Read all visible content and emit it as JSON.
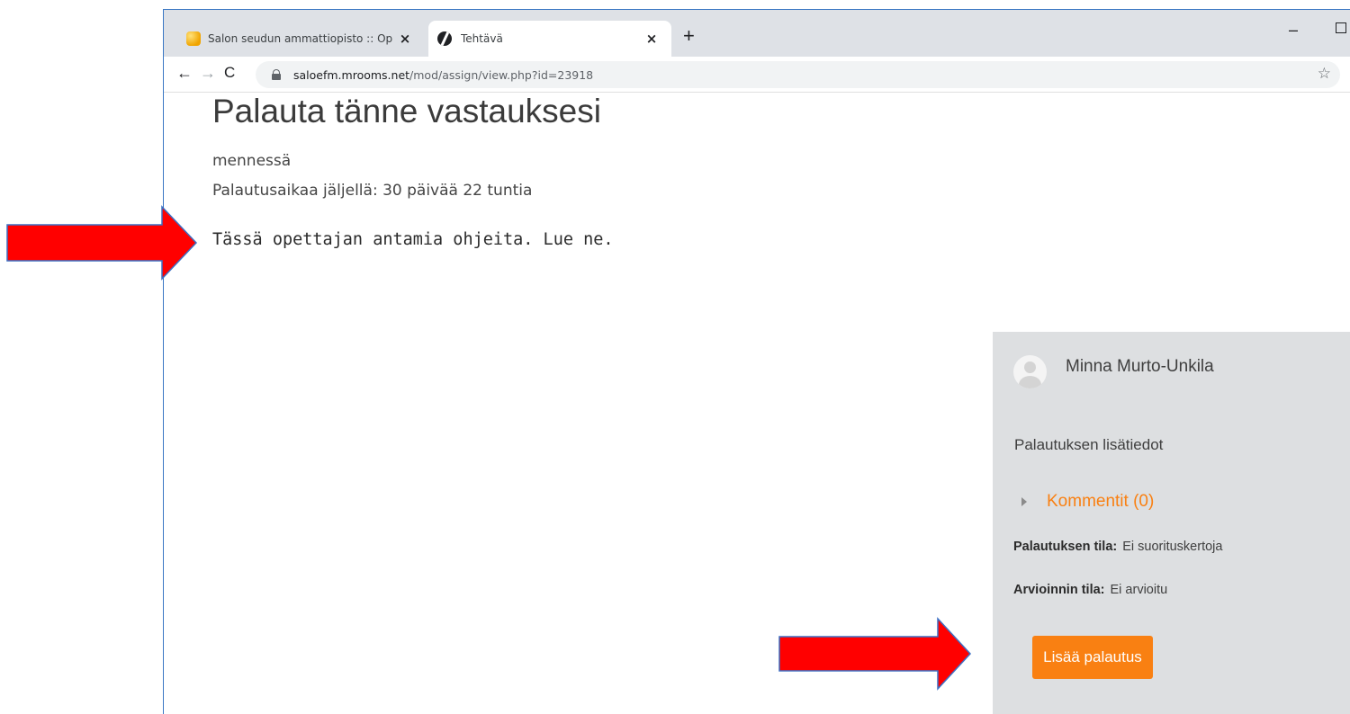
{
  "browser": {
    "tabs": [
      {
        "title": "Salon seudun ammattiopisto :: Op",
        "close": "×"
      },
      {
        "title": "Tehtävä",
        "close": "×"
      }
    ],
    "new_tab": "+",
    "min": "–",
    "url_domain": "saloefm.mrooms.net",
    "url_path": "/mod/assign/view.php?id=23918",
    "icons": [
      "back-icon",
      "forward-icon",
      "reload-icon",
      "lock-icon",
      "star-icon"
    ]
  },
  "page": {
    "title": "Palauta tänne vastauksesi",
    "due_label": "mennessä",
    "time_remaining": "Palautusaikaa jäljellä: 30 päivää 22 tuntia",
    "instructions": "Tässä opettajan antamia ohjeita. Lue ne."
  },
  "panel": {
    "user_name": "Minna Murto-Unkila",
    "subtitle": "Palautuksen lisätiedot",
    "comments": "Kommentit (0)",
    "submission_status_label": "Palautuksen tila:",
    "submission_status_value": "Ei suorituskertoja",
    "grading_status_label": "Arvioinnin tila:",
    "grading_status_value": "Ei arvioitu",
    "button_label": "Lisää palautus"
  },
  "colors": {
    "accent": "#f98012",
    "panel_bg": "#dddfe1",
    "arrow": "#ff0000",
    "arrow_outline": "#3b6fc4"
  }
}
